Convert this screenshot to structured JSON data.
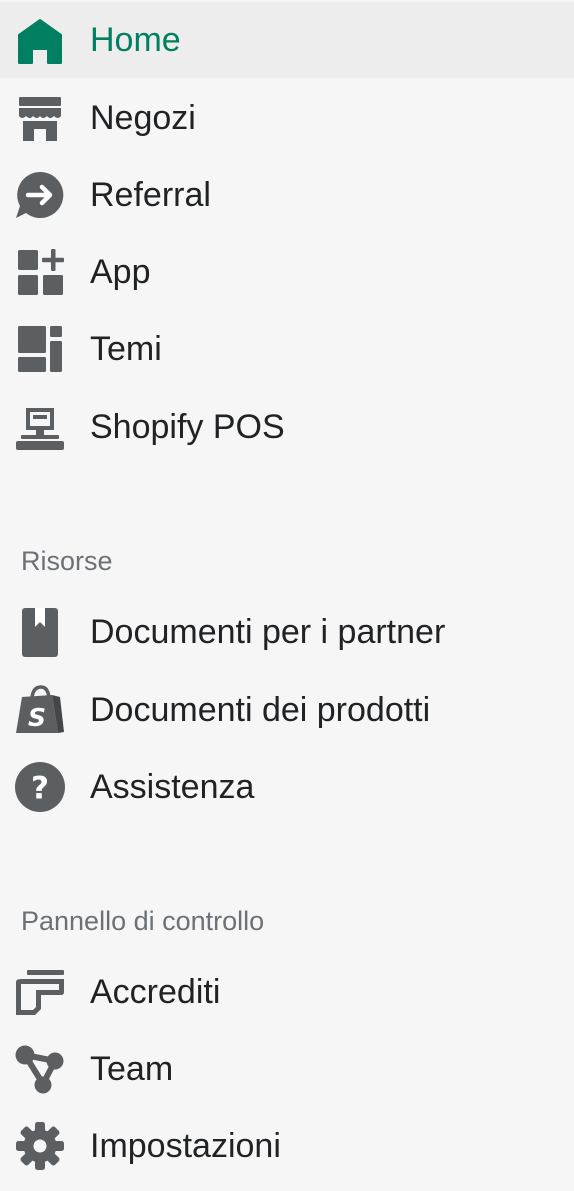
{
  "colors": {
    "active": "#008060",
    "icon": "#5c5f62",
    "text": "#202223",
    "section": "#6d7175",
    "bg": "#f6f6f7"
  },
  "nav": {
    "main": [
      {
        "label": "Home",
        "icon": "home-icon",
        "active": true
      },
      {
        "label": "Negozi",
        "icon": "store-icon"
      },
      {
        "label": "Referral",
        "icon": "referral-icon"
      },
      {
        "label": "App",
        "icon": "apps-icon"
      },
      {
        "label": "Temi",
        "icon": "themes-icon"
      },
      {
        "label": "Shopify POS",
        "icon": "pos-icon"
      }
    ],
    "resources": {
      "title": "Risorse",
      "items": [
        {
          "label": "Documenti per i partner",
          "icon": "bookmark-document-icon"
        },
        {
          "label": "Documenti dei prodotti",
          "icon": "shopify-bag-icon"
        },
        {
          "label": "Assistenza",
          "icon": "question-icon"
        }
      ]
    },
    "dashboard": {
      "title": "Pannello di controllo",
      "items": [
        {
          "label": "Accrediti",
          "icon": "payouts-icon"
        },
        {
          "label": "Team",
          "icon": "team-icon"
        },
        {
          "label": "Impostazioni",
          "icon": "settings-icon"
        }
      ]
    }
  }
}
